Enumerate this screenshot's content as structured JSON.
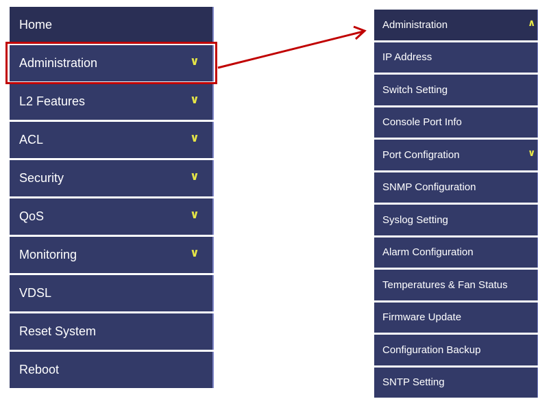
{
  "left_menu": {
    "items": [
      {
        "label": "Home",
        "has_chevron": false
      },
      {
        "label": "Administration",
        "has_chevron": true
      },
      {
        "label": "L2 Features",
        "has_chevron": true
      },
      {
        "label": "ACL",
        "has_chevron": true
      },
      {
        "label": "Security",
        "has_chevron": true
      },
      {
        "label": "QoS",
        "has_chevron": true
      },
      {
        "label": "Monitoring",
        "has_chevron": true
      },
      {
        "label": "VDSL",
        "has_chevron": false
      },
      {
        "label": "Reset System",
        "has_chevron": false
      },
      {
        "label": "Reboot",
        "has_chevron": false
      }
    ],
    "chevron_glyph": "⌄"
  },
  "right_menu": {
    "items": [
      {
        "label": "Administration",
        "chevron": "up"
      },
      {
        "label": "IP Address"
      },
      {
        "label": "Switch Setting"
      },
      {
        "label": "Console Port Info"
      },
      {
        "label": "Port Configration",
        "chevron": "down"
      },
      {
        "label": "SNMP Configuration"
      },
      {
        "label": "Syslog Setting"
      },
      {
        "label": "Alarm Configuration"
      },
      {
        "label": "Temperatures & Fan Status"
      },
      {
        "label": "Firmware Update"
      },
      {
        "label": "Configuration Backup"
      },
      {
        "label": "SNTP Setting"
      }
    ]
  },
  "colors": {
    "menu_bg": "#333a68",
    "menu_bg_dark": "#2a2f55",
    "separator": "#ffffff",
    "chevron": "#e6e646",
    "callout": "#c00000"
  }
}
